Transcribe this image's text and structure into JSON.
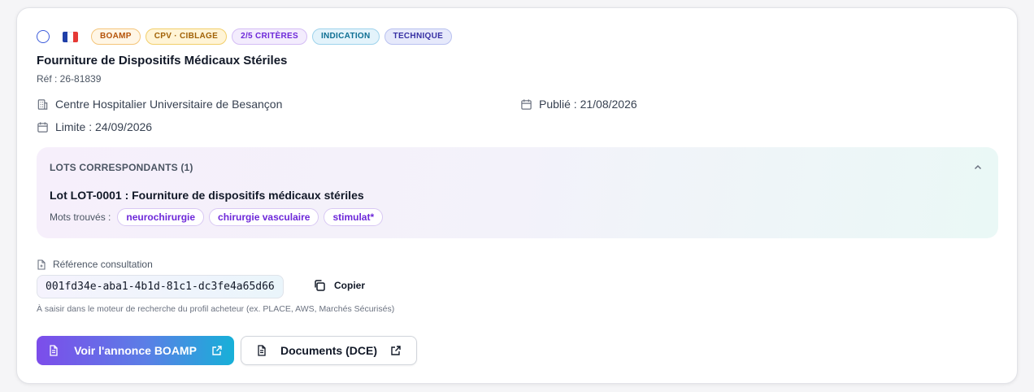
{
  "card": {
    "flag_colors": [
      "#1f3fa8",
      "#ffffff",
      "#e53935"
    ],
    "badges": [
      {
        "label": "BOAMP",
        "bg": "#fff6e6",
        "border": "#f4c57a",
        "color": "#b45309"
      },
      {
        "label": "CPV · CIBLAGE",
        "bg": "#fff4d6",
        "border": "#f2cf6b",
        "color": "#a16207"
      },
      {
        "label": "2/5 CRITÈRES",
        "bg": "#f3ecfd",
        "border": "#d4bdf5",
        "color": "#6d28d9"
      },
      {
        "label": "INDICATION",
        "bg": "#e3f3fb",
        "border": "#9fd3ec",
        "color": "#0e6f93"
      },
      {
        "label": "TECHNIQUE",
        "bg": "#e6e9fb",
        "border": "#b9c1f0",
        "color": "#3730a3"
      }
    ],
    "title": "Fourniture de Dispositifs Médicaux Stériles",
    "reference": "Réf : 26-81839",
    "buyer": "Centre Hospitalier Universitaire de Besançon",
    "published": "Publié : 21/08/2026",
    "deadline": "Limite : 24/09/2026"
  },
  "lots": {
    "heading": "LOTS CORRESPONDANTS (1)",
    "lot_title": "Lot LOT-0001 : Fourniture de dispositifs médicaux stériles",
    "keywords_label": "Mots trouvés :",
    "keywords": [
      "neurochirurgie",
      "chirurgie vasculaire",
      "stimulat*"
    ]
  },
  "consultation": {
    "label": "Référence consultation",
    "code": "001fd34e-aba1-4b1d-81c1-dc3fe4a65d66",
    "copy_label": "Copier",
    "hint": "À saisir dans le moteur de recherche du profil acheteur (ex. PLACE, AWS, Marchés Sécurisés)"
  },
  "actions": {
    "primary_label": "Voir l'annonce BOAMP",
    "secondary_label": "Documents (DCE)"
  }
}
